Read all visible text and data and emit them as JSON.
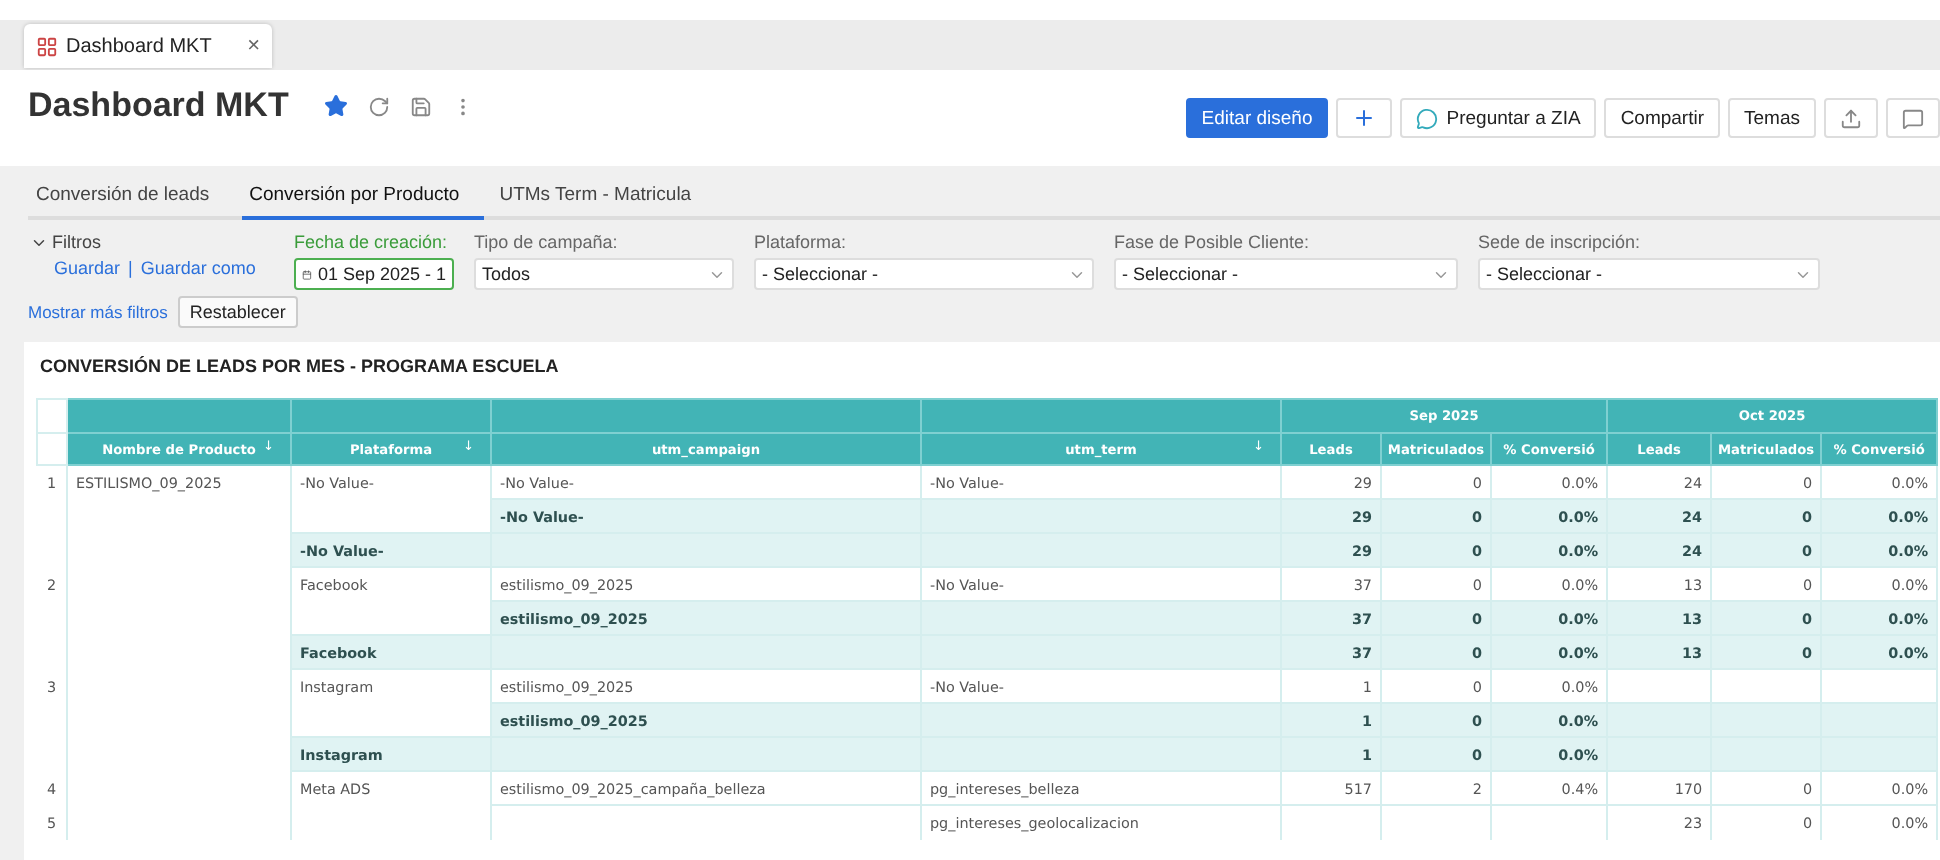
{
  "browser_tab": {
    "title": "Dashboard MKT",
    "close": "×"
  },
  "header": {
    "title": "Dashboard MKT",
    "favorite": true,
    "buttons": [
      {
        "kind": "primary",
        "label": "Editar diseño"
      },
      {
        "kind": "plus"
      },
      {
        "kind": "zia",
        "label": "Preguntar a ZIA"
      },
      {
        "kind": "plain",
        "label": "Compartir"
      },
      {
        "kind": "plain",
        "label": "Temas"
      },
      {
        "kind": "export"
      },
      {
        "kind": "comment"
      }
    ]
  },
  "tabs": [
    {
      "label": "Conversión de leads",
      "selected": false
    },
    {
      "label": "Conversión por Producto",
      "selected": true
    },
    {
      "label": "UTMs Term - Matricula",
      "selected": false
    }
  ],
  "filters": {
    "toggle": "Filtros",
    "links": [
      "Guardar",
      "Guardar como"
    ],
    "separator": "|",
    "more": "Mostrar más filtros",
    "reset": "Restablecer",
    "fields": [
      {
        "kind": "date",
        "label": "Fecha de creación:",
        "value": "01 Sep 2025 - 1"
      },
      {
        "kind": "select",
        "label": "Tipo de campaña:",
        "value": "Todos"
      },
      {
        "kind": "select",
        "label": "Plataforma:",
        "value": "- Seleccionar -"
      },
      {
        "kind": "select",
        "label": "Fase de Posible Cliente:",
        "value": "- Seleccionar -"
      },
      {
        "kind": "select",
        "label": "Sede de inscripción:",
        "value": "- Seleccionar -"
      }
    ]
  },
  "report": {
    "title": "CONVERSIÓN DE LEADS POR MES - PROGRAMA ESCUELA",
    "columns": [
      {
        "label": "Nombre de Producto",
        "sort": "↓"
      },
      {
        "label": "Plataforma",
        "sort": "↓"
      },
      {
        "label": "utm_campaign"
      },
      {
        "label": "utm_term",
        "sort": "↓"
      }
    ],
    "months": [
      {
        "label": "Sep 2025",
        "columns": [
          "Leads",
          "Matriculados",
          "% Conversió"
        ]
      },
      {
        "label": "Oct 2025",
        "columns": [
          "Leads",
          "Matriculados",
          "% Conversió"
        ]
      }
    ],
    "rows": [
      {
        "kind": "detail",
        "number": "1",
        "product": "ESTILISMO_09_2025",
        "platform": "-No Value-",
        "campaign": "-No Value-",
        "term": "-No Value-",
        "months": [
          {
            "kind": "data",
            "values": [
              "29",
              "0",
              "0.0%"
            ]
          },
          {
            "kind": "data",
            "values": [
              "24",
              "0",
              "0.0%"
            ]
          }
        ]
      },
      {
        "kind": "campaign_total",
        "campaign": "-No Value-",
        "months": [
          {
            "kind": "data",
            "values": [
              "29",
              "0",
              "0.0%"
            ]
          },
          {
            "kind": "data",
            "values": [
              "24",
              "0",
              "0.0%"
            ]
          }
        ]
      },
      {
        "kind": "platform_total",
        "platform": "-No Value-",
        "months": [
          {
            "kind": "data",
            "values": [
              "29",
              "0",
              "0.0%"
            ]
          },
          {
            "kind": "data",
            "values": [
              "24",
              "0",
              "0.0%"
            ]
          }
        ]
      },
      {
        "kind": "detail",
        "number": "2",
        "platform": "Facebook",
        "campaign": "estilismo_09_2025",
        "term": "-No Value-",
        "months": [
          {
            "kind": "data",
            "values": [
              "37",
              "0",
              "0.0%"
            ]
          },
          {
            "kind": "data",
            "values": [
              "13",
              "0",
              "0.0%"
            ]
          }
        ]
      },
      {
        "kind": "campaign_total",
        "campaign": "estilismo_09_2025",
        "months": [
          {
            "kind": "data",
            "values": [
              "37",
              "0",
              "0.0%"
            ]
          },
          {
            "kind": "data",
            "values": [
              "13",
              "0",
              "0.0%"
            ]
          }
        ]
      },
      {
        "kind": "platform_total",
        "platform": "Facebook",
        "months": [
          {
            "kind": "data",
            "values": [
              "37",
              "0",
              "0.0%"
            ]
          },
          {
            "kind": "data",
            "values": [
              "13",
              "0",
              "0.0%"
            ]
          }
        ]
      },
      {
        "kind": "detail",
        "number": "3",
        "platform": "Instagram",
        "campaign": "estilismo_09_2025",
        "term": "-No Value-",
        "months": [
          {
            "kind": "data",
            "values": [
              "1",
              "0",
              "0.0%"
            ]
          },
          {
            "kind": "blank"
          }
        ]
      },
      {
        "kind": "campaign_total",
        "campaign": "estilismo_09_2025",
        "months": [
          {
            "kind": "data",
            "values": [
              "1",
              "0",
              "0.0%"
            ]
          },
          {
            "kind": "blank"
          }
        ]
      },
      {
        "kind": "platform_total",
        "platform": "Instagram",
        "months": [
          {
            "kind": "data",
            "values": [
              "1",
              "0",
              "0.0%"
            ]
          },
          {
            "kind": "blank"
          }
        ]
      },
      {
        "kind": "detail",
        "number": "4",
        "platform": "Meta ADS",
        "campaign": "estilismo_09_2025_campaña_belleza",
        "term": "pg_intereses_belleza",
        "months": [
          {
            "kind": "data",
            "values": [
              "517",
              "2",
              "0.4%"
            ]
          },
          {
            "kind": "data",
            "values": [
              "170",
              "0",
              "0.0%"
            ]
          }
        ]
      },
      {
        "kind": "detail",
        "number": "5",
        "term": "pg_intereses_geolocalizacion",
        "months": [
          {
            "kind": "blank"
          },
          {
            "kind": "data",
            "values": [
              "23",
              "0",
              "0.0%"
            ]
          }
        ]
      }
    ]
  }
}
